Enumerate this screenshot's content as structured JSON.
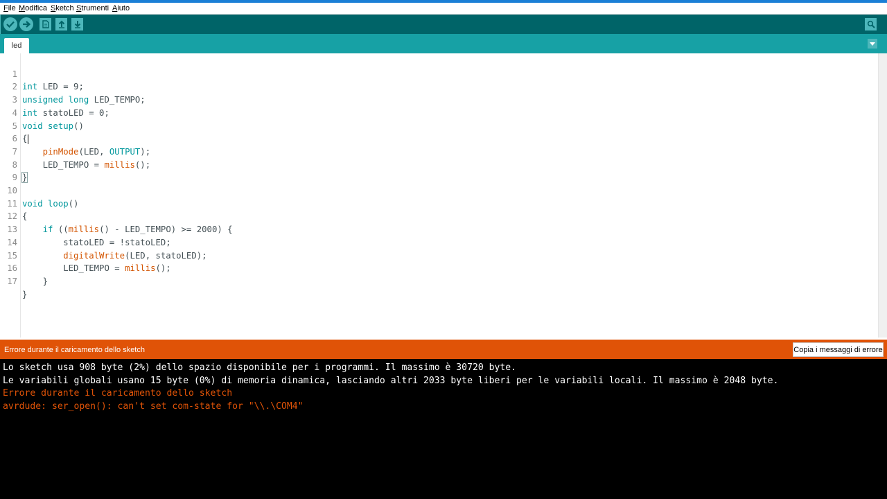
{
  "menu": {
    "items": [
      {
        "label": "File",
        "accel": "F",
        "rest": "ile"
      },
      {
        "label": "Modifica",
        "accel": "M",
        "rest": "odifica"
      },
      {
        "label": "Sketch",
        "accel": "S",
        "rest": "ketch"
      },
      {
        "label": "Strumenti",
        "accel": "S",
        "rest": "trumenti"
      },
      {
        "label": "Aiuto",
        "accel": "A",
        "rest": "iuto"
      }
    ]
  },
  "toolbar": {
    "buttons": [
      "verify-icon",
      "upload-icon",
      "new-icon",
      "open-icon",
      "save-icon"
    ],
    "serial_monitor": "serial-monitor-icon"
  },
  "tabs": [
    {
      "label": "led"
    }
  ],
  "editor": {
    "line_numbers": [
      "1",
      "2",
      "3",
      "4",
      "5",
      "6",
      "7",
      "8",
      "9",
      "10",
      "11",
      "12",
      "13",
      "14",
      "15",
      "16",
      "17"
    ],
    "lines": [
      "int LED = 9;",
      "unsigned long LED_TEMPO;",
      "int statoLED = 0;",
      "void setup()",
      "{",
      "    pinMode(LED, OUTPUT);",
      "    LED_TEMPO = millis();",
      "}",
      "",
      "void loop()",
      "{",
      "    if ((millis() - LED_TEMPO) >= 2000) {",
      "        statoLED = !statoLED;",
      "        digitalWrite(LED, statoLED);",
      "        LED_TEMPO = millis();",
      "    }",
      "}"
    ]
  },
  "status": {
    "message": "Errore durante il caricamento dello sketch",
    "copy_button": "Copia i messaggi di errore"
  },
  "console": {
    "lines": [
      {
        "text": "Lo sketch usa 908 byte (2%) dello spazio disponibile per i programmi. Il massimo è 30720 byte.",
        "kind": "info"
      },
      {
        "text": "Le variabili globali usano 15 byte (0%) di memoria dinamica, lasciando altri 2033 byte liberi per le variabili locali. Il massimo è 2048 byte.",
        "kind": "info"
      },
      {
        "text": "Errore durante il caricamento dello sketch",
        "kind": "error"
      },
      {
        "text": "avrdude: ser_open(): can't set com-state for \"\\\\.\\COM4\"",
        "kind": "error"
      }
    ]
  },
  "colors": {
    "toolbar": "#006468",
    "tabbar": "#17a1a5",
    "status_error": "#e05307",
    "keyword": "#00979c",
    "function": "#d35400"
  }
}
